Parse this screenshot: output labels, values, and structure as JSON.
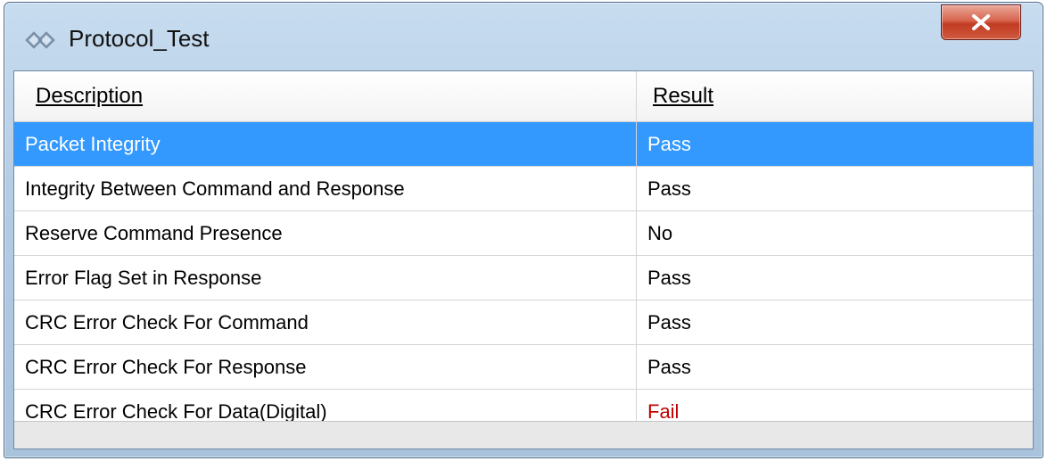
{
  "window": {
    "title": "Protocol_Test",
    "close_label": "close-icon"
  },
  "table": {
    "columns": [
      "Description",
      "Result"
    ],
    "rows": [
      {
        "description": "Packet Integrity",
        "result": "Pass",
        "selected": true
      },
      {
        "description": "Integrity Between Command and Response",
        "result": "Pass",
        "selected": false
      },
      {
        "description": "Reserve Command Presence",
        "result": "No",
        "selected": false
      },
      {
        "description": "Error Flag Set in Response",
        "result": "Pass",
        "selected": false
      },
      {
        "description": "CRC Error Check For Command",
        "result": "Pass",
        "selected": false
      },
      {
        "description": "CRC Error Check For Response",
        "result": "Pass",
        "selected": false
      },
      {
        "description": "CRC Error Check For Data(Digital)",
        "result": "Fail",
        "selected": false
      }
    ]
  },
  "colors": {
    "selection": "#3399ff",
    "fail_text": "#c00000",
    "title_bar": "#b3cbe3",
    "close_button": "#c23b22"
  }
}
